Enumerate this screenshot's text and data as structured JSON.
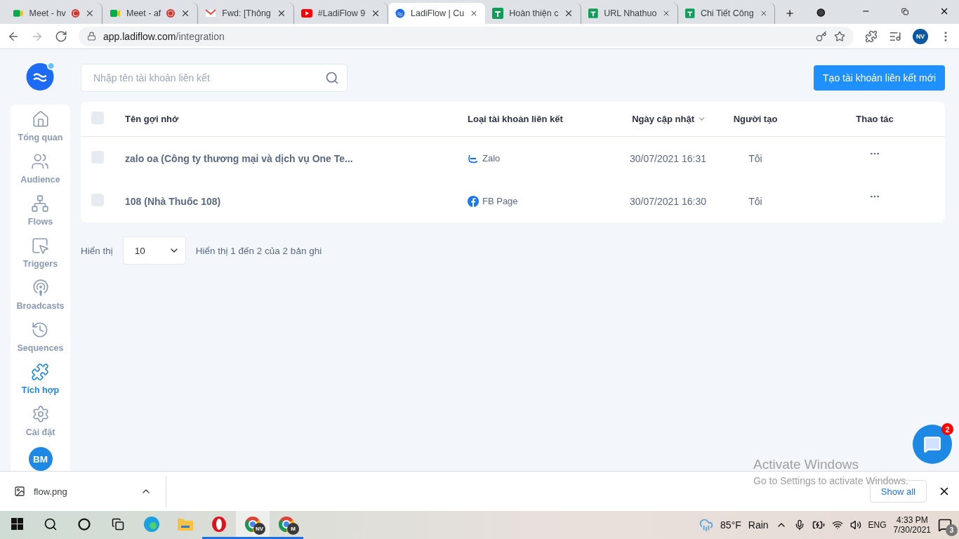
{
  "browser": {
    "tabs": [
      {
        "kind": "meet",
        "title": "Meet - hv",
        "recording": true,
        "selected": false
      },
      {
        "kind": "meet",
        "title": "Meet - af",
        "recording": true,
        "selected": false
      },
      {
        "kind": "gmail",
        "title": "Fwd: [Thông",
        "recording": false,
        "selected": false
      },
      {
        "kind": "youtube",
        "title": "#LadiFlow 9",
        "recording": false,
        "selected": false
      },
      {
        "kind": "ladiflow",
        "title": "LadiFlow | Cu",
        "recording": false,
        "selected": true
      },
      {
        "kind": "sheets",
        "title": "Hoàn thiện c",
        "recording": false,
        "selected": false
      },
      {
        "kind": "sheets",
        "title": "URL Nhathuo",
        "recording": false,
        "selected": false
      },
      {
        "kind": "sheets",
        "title": "Chi Tiết Công",
        "recording": false,
        "selected": false
      }
    ],
    "url_host": "app.ladiflow.com",
    "url_path": "/integration",
    "profile": "NV"
  },
  "sidebar": {
    "items": [
      {
        "kind": "home",
        "label": "Tổng quan",
        "selected": false
      },
      {
        "kind": "audience",
        "label": "Audience",
        "selected": false
      },
      {
        "kind": "flows",
        "label": "Flows",
        "selected": false
      },
      {
        "kind": "triggers",
        "label": "Triggers",
        "selected": false
      },
      {
        "kind": "broadcasts",
        "label": "Broadcasts",
        "selected": false
      },
      {
        "kind": "sequences",
        "label": "Sequences",
        "selected": false
      },
      {
        "kind": "integration",
        "label": "Tích hợp",
        "selected": true
      },
      {
        "kind": "settings",
        "label": "Cài đặt",
        "selected": false
      }
    ],
    "avatar": "BM"
  },
  "search": {
    "placeholder": "Nhập tên tài khoản liên kết"
  },
  "create_button": "Tạo tài khoản liên kết mới",
  "table": {
    "columns": [
      "Tên gợi nhớ",
      "Loại tài khoản liên kết",
      "Ngày cập nhật",
      "Người tạo",
      "Thao tác"
    ],
    "header_checked": false,
    "rows": [
      {
        "checked": false,
        "name": "zalo oa (Công ty thương mại và dịch vụ One Te...",
        "kind": "zalo",
        "type": "Zalo",
        "updated": "30/07/2021 16:31",
        "creator": "Tôi"
      },
      {
        "checked": false,
        "name": "108 (Nhà Thuốc 108)",
        "kind": "facebook",
        "type": "FB Page",
        "updated": "30/07/2021 16:30",
        "creator": "Tôi"
      }
    ]
  },
  "pagination": {
    "label": "Hiển thị",
    "page_size": "10",
    "summary": "Hiển thị 1 đến 2 của 2 bản ghi"
  },
  "chat_widget": {
    "badge": "2"
  },
  "os_notice": {
    "title": "Activate Windows",
    "text": "Go to Settings to activate Windows."
  },
  "download_bar": {
    "file": "flow.png",
    "show_all": "Show all"
  },
  "taskbar": {
    "apps": [
      {
        "kind": "edge",
        "running": false,
        "selected": false
      },
      {
        "kind": "explorer",
        "running": false,
        "selected": false
      },
      {
        "kind": "opera",
        "running": true,
        "selected": false
      },
      {
        "kind": "chrome",
        "badge": "NV",
        "running": true,
        "selected": true
      },
      {
        "kind": "chrome",
        "badge": "M",
        "running": true,
        "selected": false
      }
    ],
    "temperature": "85°F",
    "weather": "Rain",
    "language": "ENG",
    "time": "4:33 PM",
    "date": "7/30/2021",
    "notifications": "3"
  }
}
